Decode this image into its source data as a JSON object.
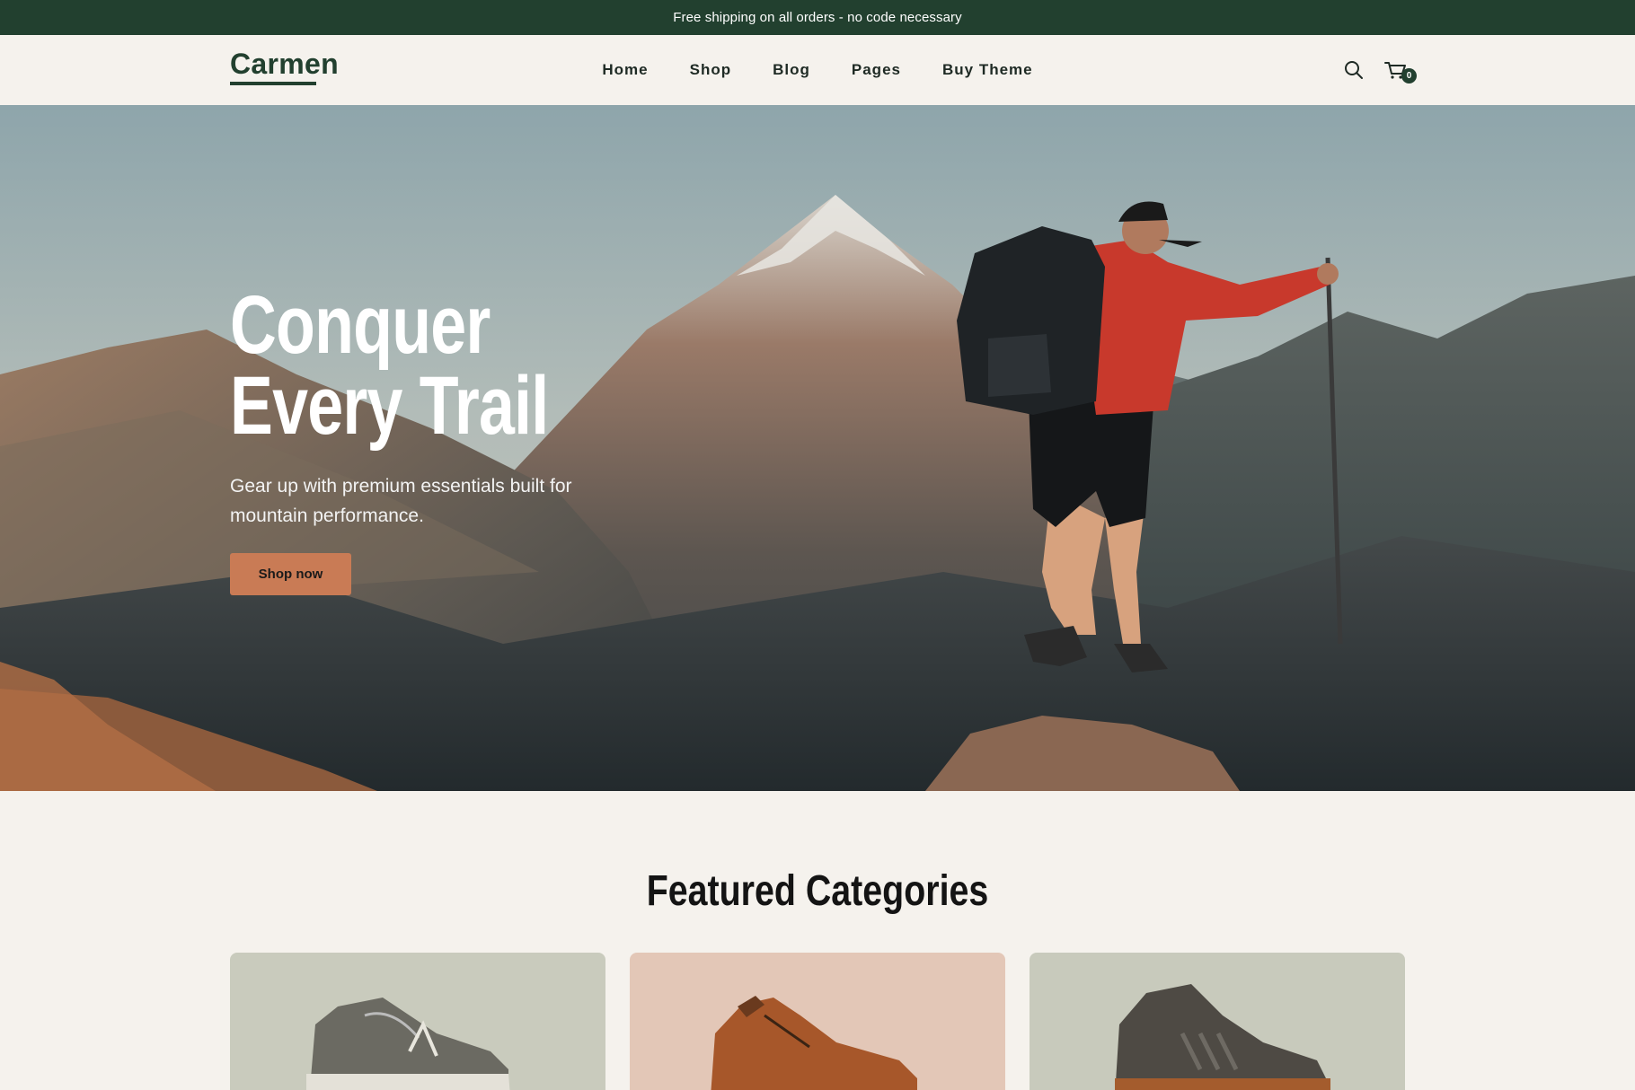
{
  "announcement": "Free shipping on all orders - no code necessary",
  "brand": "Carmen",
  "nav": [
    {
      "label": "Home"
    },
    {
      "label": "Shop"
    },
    {
      "label": "Blog"
    },
    {
      "label": "Pages"
    },
    {
      "label": "Buy Theme"
    }
  ],
  "header_icons": {
    "search": "search-icon",
    "cart": "cart-icon"
  },
  "cart_count": "0",
  "hero": {
    "title_line1": "Conquer",
    "title_line2": "Every Trail",
    "subtitle": "Gear up with premium essentials built for mountain performance.",
    "cta_label": "Shop now"
  },
  "featured": {
    "title": "Featured Categories"
  },
  "colors": {
    "brand_green": "#22402f",
    "cta_orange": "#c97b55",
    "page_bg": "#f5f2ed",
    "card_sage": "#c9cbbd",
    "card_peach": "#e3c7b7"
  }
}
